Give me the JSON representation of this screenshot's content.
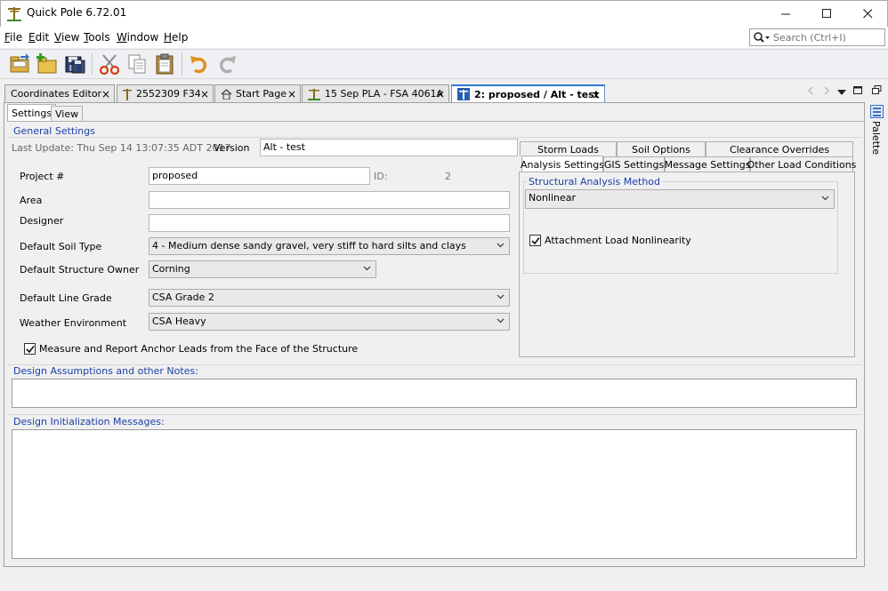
{
  "window": {
    "title": "Quick Pole 6.72.01"
  },
  "menu": [
    {
      "label": "File",
      "key": "F",
      "rest": "ile"
    },
    {
      "label": "Edit",
      "key": "E",
      "rest": "dit"
    },
    {
      "label": "View",
      "key": "V",
      "rest": "iew"
    },
    {
      "label": "Tools",
      "key": "T",
      "rest": "ools"
    },
    {
      "label": "Window",
      "key": "W",
      "rest": "indow"
    },
    {
      "label": "Help",
      "key": "H",
      "rest": "elp"
    }
  ],
  "search": {
    "placeholder": "Search (Ctrl+I)"
  },
  "toolbar": {
    "icons": [
      "open-folder-icon",
      "new-folder-icon",
      "save-icon",
      "cut-icon",
      "copy-icon",
      "paste-icon",
      "undo-icon",
      "redo-icon"
    ]
  },
  "doc_tabs": [
    {
      "label": "Coordinates Editor",
      "close": "×"
    },
    {
      "label": "2552309 F34",
      "close": "×"
    },
    {
      "label": "Start Page",
      "close": "×"
    },
    {
      "label": "15 Sep PLA - FSA 4061A",
      "close": "×"
    },
    {
      "label": "2: proposed / Alt - test",
      "close": "×",
      "active": true
    }
  ],
  "subtabs": [
    "Settings",
    "View"
  ],
  "general": {
    "title": "General Settings",
    "last_update": "Last Update: Thu Sep 14 13:07:35 ADT 2017",
    "version_label": "Version",
    "version_value": "Alt - test",
    "project_label": "Project #",
    "project_value": "proposed",
    "id_label": "ID:",
    "id_value": "2",
    "area_label": "Area",
    "area_value": "",
    "designer_label": "Designer",
    "designer_value": "",
    "soil_label": "Default Soil Type",
    "soil_value": "4 - Medium dense sandy gravel, very stiff to hard silts and clays",
    "owner_label": "Default Structure Owner",
    "owner_value": "Corning",
    "grade_label": "Default Line Grade",
    "grade_value": "CSA Grade 2",
    "weather_label": "Weather Environment",
    "weather_value": "CSA Heavy",
    "anchor_checkbox": "Measure and Report Anchor Leads from the Face of the Structure",
    "anchor_checked": true
  },
  "right_tabs": {
    "row1": [
      "Storm Loads",
      "Soil Options",
      "Clearance Overrides"
    ],
    "row2": [
      "Analysis Settings",
      "GIS Settings",
      "Message Settings",
      "Other Load Conditions"
    ]
  },
  "analysis": {
    "group_title": "Structural Analysis Method",
    "method_value": "Nonlinear",
    "nonlinearity_label": "Attachment Load Nonlinearity",
    "nonlinearity_checked": true
  },
  "notes": {
    "title": "Design Assumptions and other Notes:"
  },
  "messages": {
    "title": "Design Initialization Messages:"
  },
  "palette": {
    "label": "Palette"
  },
  "colors": {
    "section_title": "#1a3fa8",
    "active_tab_accent": "#2e7bd6"
  }
}
